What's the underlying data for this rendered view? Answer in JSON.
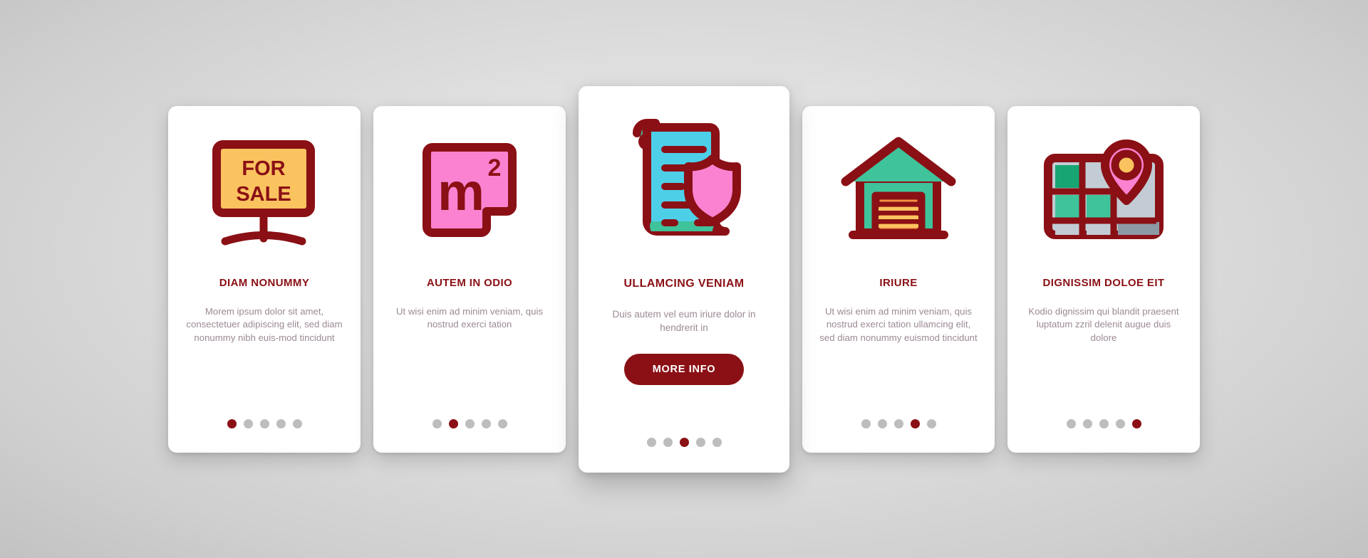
{
  "theme": {
    "background": "#e3e3e3",
    "card_background": "#ffffff",
    "accent_dark_red": "#8a1015",
    "body_text": "#9b8a95",
    "dot_inactive": "#bdbdbd",
    "icon_outline": "#8a1015",
    "icon_yellow": "#fbc35f",
    "icon_pink": "#fa82d0",
    "icon_cyan": "#4ecfe8",
    "icon_teal": "#3fc39b",
    "icon_orange": "#f59046",
    "icon_gray_blue": "#c3ccd4"
  },
  "cards": [
    {
      "id": "card-for-sale",
      "icon": "for-sale-sign-icon",
      "icon_text_line1": "FOR",
      "icon_text_line2": "SALE",
      "title": "DIAM NONUMMY",
      "body": "Morem ipsum dolor sit amet, consectetuer adipiscing elit, sed diam nonummy nibh euis-mod tincidunt",
      "featured": false,
      "dots": {
        "count": 5,
        "active_index": 0
      }
    },
    {
      "id": "card-square-meters",
      "icon": "square-meters-icon",
      "icon_text_line1": "m",
      "icon_text_line2": "2",
      "title": "AUTEM IN ODIO",
      "body": "Ut wisi enim ad minim veniam, quis nostrud exerci tation",
      "featured": false,
      "dots": {
        "count": 5,
        "active_index": 1
      }
    },
    {
      "id": "card-contract-shield",
      "icon": "contract-shield-icon",
      "title": "ULLAMCING VENIAM",
      "body": "Duis autem vel eum iriure dolor in hendrerit in",
      "cta_label": "MORE INFO",
      "featured": true,
      "dots": {
        "count": 5,
        "active_index": 2
      }
    },
    {
      "id": "card-garage",
      "icon": "garage-icon",
      "title": "IRIURE",
      "body": "Ut wisi enim ad minim veniam, quis nostrud exerci tation ullamcing elit, sed diam nonummy euismod tincidunt",
      "featured": false,
      "dots": {
        "count": 5,
        "active_index": 3
      }
    },
    {
      "id": "card-map-location",
      "icon": "map-location-pin-icon",
      "title": "DIGNISSIM DOLOE EIT",
      "body": "Kodio dignissim qui blandit praesent luptatum zzril delenit augue duis dolore",
      "featured": false,
      "dots": {
        "count": 5,
        "active_index": 4
      }
    }
  ]
}
